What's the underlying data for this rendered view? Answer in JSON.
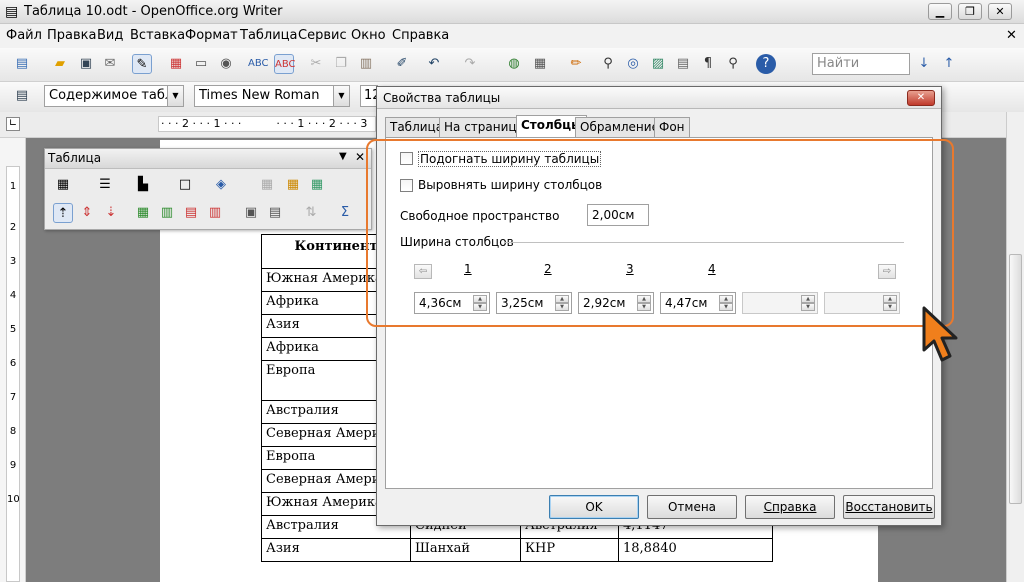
{
  "window": {
    "title": "Таблица 10.odt - OpenOffice.org Writer",
    "minimize": "▁",
    "maximize": "❐",
    "close": "✕"
  },
  "menu": [
    "Файл",
    "Правка",
    "Вид",
    "Вставка",
    "Формат",
    "Таблица",
    "Сервис",
    "Окно",
    "Справка"
  ],
  "menu_close": "✕",
  "toolbar": {
    "find_placeholder": "Найти"
  },
  "format_bar": {
    "style": "Содержимое таблиц",
    "font": "Times New Roman",
    "size": "12"
  },
  "ruler": {
    "marks": "· · · 2 · · · 1 · · ·          · · · 1 · · · 2 · · · 3"
  },
  "vruler": [
    "1",
    "2",
    "3",
    "4",
    "5",
    "6",
    "7",
    "8",
    "9",
    "10"
  ],
  "table_panel": {
    "title": "Таблица",
    "close": "✕"
  },
  "doc_table": {
    "header": "Континент",
    "rows": [
      [
        "Южная Америка",
        "",
        "",
        ""
      ],
      [
        "Африка",
        "",
        "",
        ""
      ],
      [
        "Азия",
        "",
        "",
        ""
      ],
      [
        "Африка",
        "",
        "",
        ""
      ],
      [
        "Европа",
        "",
        "",
        ""
      ],
      [
        "Австралия",
        "",
        "",
        ""
      ],
      [
        "Северная Америк",
        "",
        "",
        ""
      ],
      [
        "Европа",
        "",
        "",
        ""
      ],
      [
        "Северная Америк",
        "",
        "",
        ""
      ],
      [
        "Южная Америка",
        "",
        "",
        ""
      ],
      [
        "Австралия",
        "Сидней",
        "Австралия",
        "4,1147"
      ],
      [
        "Азия",
        "Шанхай",
        "КНР",
        "18,8840"
      ]
    ]
  },
  "dialog": {
    "title": "Свойства таблицы",
    "close": "✕",
    "tabs": [
      "Таблица",
      "На странице",
      "Столбцы",
      "Обрамление",
      "Фон"
    ],
    "active_tab": "Столбцы",
    "fit_width_label": "Подогнать ширину таблицы",
    "fit_width_checked": false,
    "equal_width_label": "Выровнять ширину столбцов",
    "equal_width_checked": false,
    "free_space_label": "Свободное пространство",
    "free_space_value": "2,00см",
    "col_width_group": "Ширина столбцов",
    "col_numbers": [
      "1",
      "2",
      "3",
      "4"
    ],
    "col_widths": [
      "4,36см",
      "3,25см",
      "2,92см",
      "4,47см",
      "",
      ""
    ],
    "prev_arrow": "⇦",
    "next_arrow": "⇨",
    "buttons": {
      "ok": "OK",
      "cancel": "Отмена",
      "help": "Справка",
      "reset": "Восстановить"
    }
  },
  "colors": {
    "highlight": "#e8792e",
    "cursor": "#f07f1c"
  }
}
